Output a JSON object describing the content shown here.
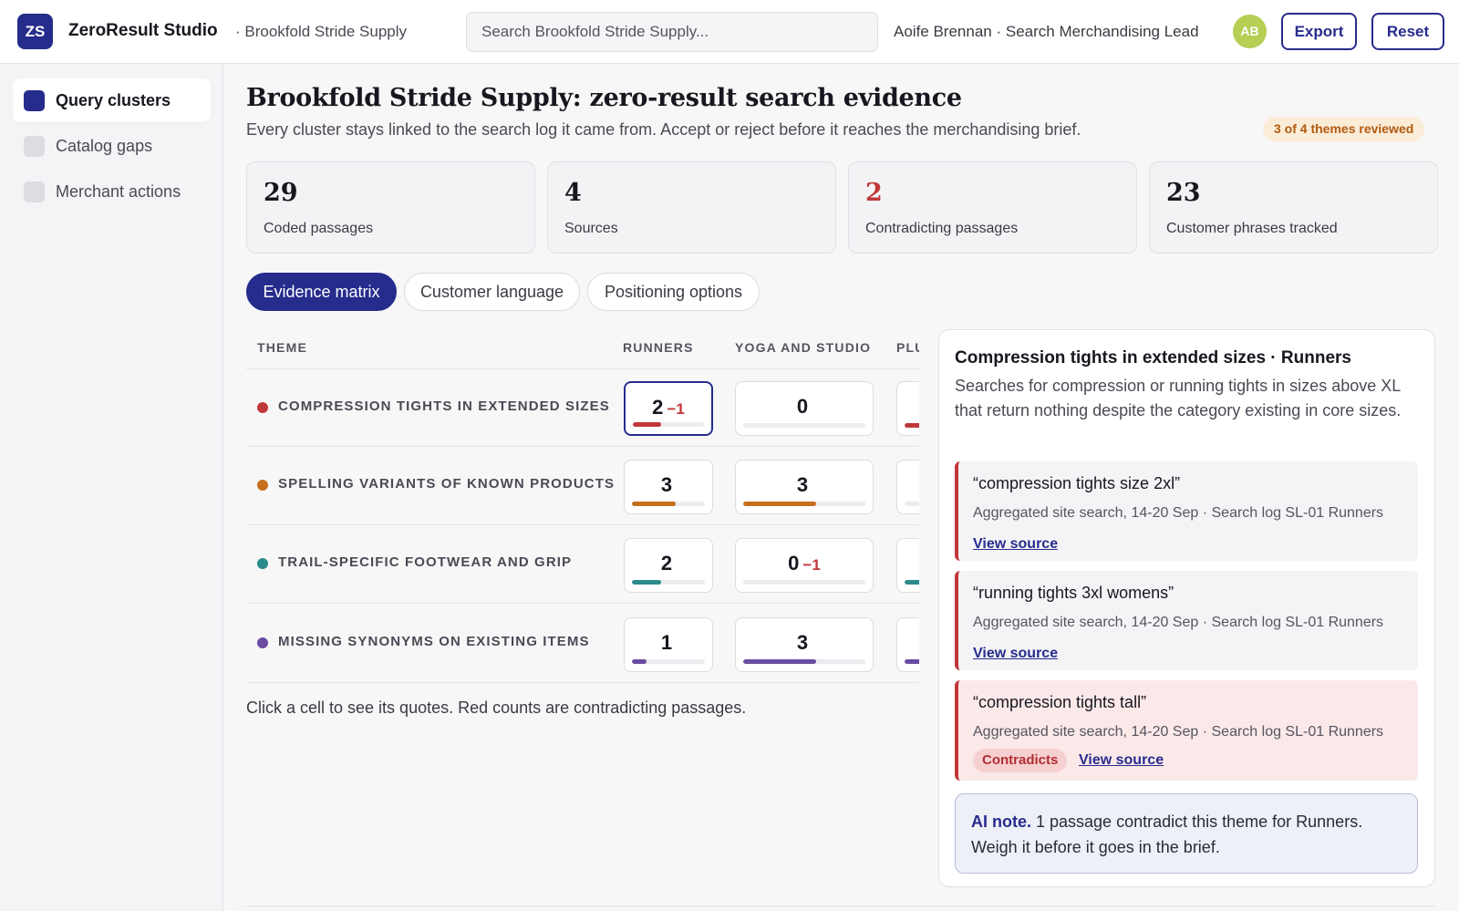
{
  "topbar": {
    "logo_initials": "ZS",
    "app_name": "ZeroResult Studio",
    "workspace": "· Brookfold Stride Supply",
    "search_placeholder": "Search Brookfold Stride Supply...",
    "user_label": "Aoife Brennan · Search Merchandising Lead",
    "avatar_initials": "AB",
    "export_label": "Export",
    "reset_label": "Reset"
  },
  "sidebar": {
    "items": [
      {
        "label": "Query clusters",
        "active": true
      },
      {
        "label": "Catalog gaps",
        "active": false
      },
      {
        "label": "Merchant actions",
        "active": false
      }
    ]
  },
  "header": {
    "title": "Brookfold Stride Supply: zero-result search evidence",
    "subtitle": "Every cluster stays linked to the search log it came from. Accept or reject before it reaches the merchandising brief.",
    "reviewed": "3 of 4 themes reviewed"
  },
  "stats": [
    {
      "value": "29",
      "label": "Coded passages",
      "highlight": false
    },
    {
      "value": "4",
      "label": "Sources",
      "highlight": false
    },
    {
      "value": "2",
      "label": "Contradicting passages",
      "highlight": true
    },
    {
      "value": "23",
      "label": "Customer phrases tracked",
      "highlight": false
    }
  ],
  "tabs": [
    {
      "label": "Evidence matrix",
      "active": true
    },
    {
      "label": "Customer language",
      "active": false
    },
    {
      "label": "Positioning options",
      "active": false
    }
  ],
  "matrix": {
    "columns": [
      "THEME",
      "RUNNERS",
      "YOGA AND STUDIO",
      "PLUS"
    ],
    "rows": [
      {
        "theme": "COMPRESSION TIGHTS IN EXTENDED SIZES",
        "color": "#c0373a",
        "cells": [
          {
            "count": "2",
            "contra": "−1",
            "level": 0.4
          },
          {
            "count": "0",
            "contra": "",
            "level": 0
          },
          {
            "count": "",
            "contra": "",
            "level": 0.5
          }
        ]
      },
      {
        "theme": "SPELLING VARIANTS OF KNOWN PRODUCTS",
        "color": "#c66f1c",
        "cells": [
          {
            "count": "3",
            "contra": "",
            "level": 0.6
          },
          {
            "count": "3",
            "contra": "",
            "level": 0.6
          },
          {
            "count": "",
            "contra": "",
            "level": 0
          }
        ]
      },
      {
        "theme": "TRAIL-SPECIFIC FOOTWEAR AND GRIP",
        "color": "#2b8a8c",
        "cells": [
          {
            "count": "2",
            "contra": "",
            "level": 0.4
          },
          {
            "count": "0",
            "contra": "−1",
            "level": 0
          },
          {
            "count": "",
            "contra": "",
            "level": 0.5
          }
        ]
      },
      {
        "theme": "MISSING SYNONYMS ON EXISTING ITEMS",
        "color": "#6a4ba0",
        "cells": [
          {
            "count": "1",
            "contra": "",
            "level": 0.2
          },
          {
            "count": "3",
            "contra": "",
            "level": 0.6
          },
          {
            "count": "",
            "contra": "",
            "level": 0.5
          }
        ]
      }
    ],
    "note": "Click a cell to see its quotes. Red counts are contradicting passages."
  },
  "detail": {
    "title": "Compression tights in extended sizes · Runners",
    "description": "Searches for compression or running tights in sizes above XL that return nothing despite the category existing in core sizes.",
    "quotes": [
      {
        "text": "“compression tights size 2xl”",
        "meta": "Aggregated site search, 14-20 Sep · Search log SL-01  Runners",
        "link": "View source",
        "badge": ""
      },
      {
        "text": "“running tights 3xl womens”",
        "meta": "Aggregated site search, 14-20 Sep · Search log SL-01  Runners",
        "link": "View source",
        "badge": ""
      },
      {
        "text": "“compression tights tall”",
        "meta": "Aggregated site search, 14-20 Sep · Search log SL-01  Runners",
        "link": "View source",
        "badge": "Contradicts"
      }
    ],
    "ai_note_label": "AI note.",
    "ai_note_text": " 1 passage contradict this theme for Runners. Weigh it before it goes in the brief."
  }
}
